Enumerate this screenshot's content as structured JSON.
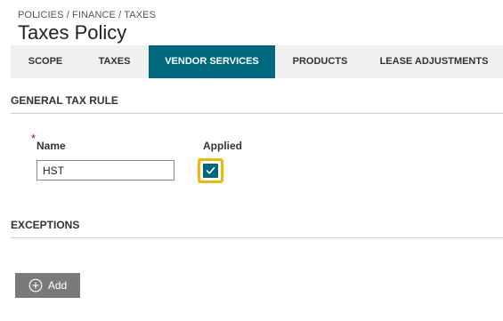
{
  "breadcrumb": "POLICIES / FINANCE / TAXES",
  "page_title": "Taxes Policy",
  "tabs": [
    {
      "label": "SCOPE",
      "active": false
    },
    {
      "label": "TAXES",
      "active": false
    },
    {
      "label": "VENDOR SERVICES",
      "active": true
    },
    {
      "label": "PRODUCTS",
      "active": false
    },
    {
      "label": "LEASE ADJUSTMENTS",
      "active": false
    }
  ],
  "general_tax_rule": {
    "title": "GENERAL TAX RULE",
    "required_mark": "*",
    "name_label": "Name",
    "name_value": "HST",
    "applied_label": "Applied",
    "applied_checked": true
  },
  "exceptions": {
    "title": "EXCEPTIONS",
    "add_label": "Add",
    "add_icon": "plus-circle-icon"
  },
  "colors": {
    "accent": "#00687d",
    "highlight": "#f2b705",
    "button_gray": "#7a7a7a"
  }
}
